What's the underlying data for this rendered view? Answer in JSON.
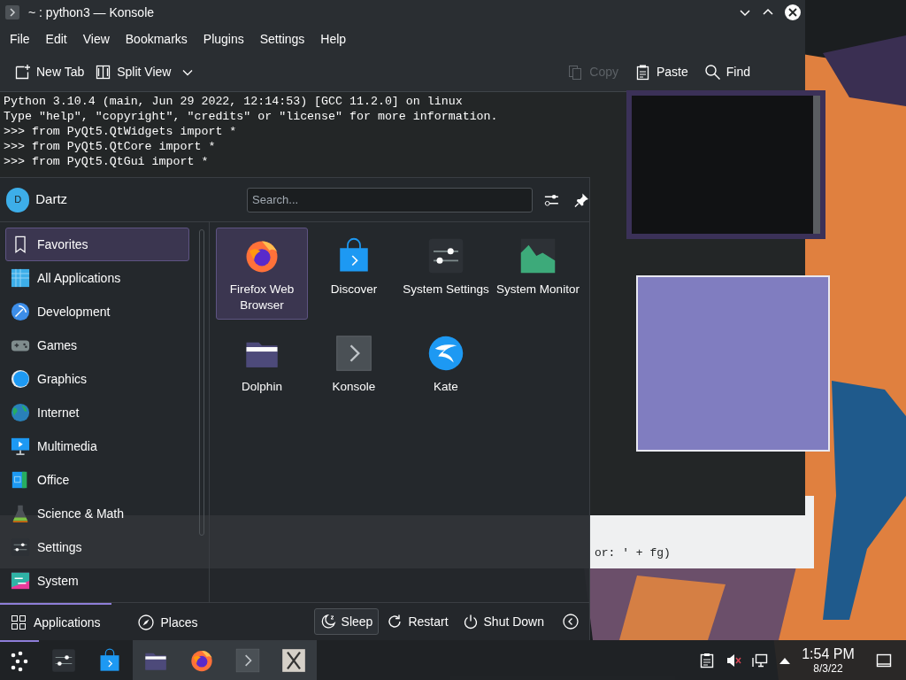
{
  "konsole": {
    "title": "~ : python3 — Konsole",
    "menu": [
      "File",
      "Edit",
      "View",
      "Bookmarks",
      "Plugins",
      "Settings",
      "Help"
    ],
    "toolbar": [
      {
        "kind": "new-tab",
        "label": "New Tab",
        "disabled": false
      },
      {
        "kind": "split-view",
        "label": "Split View",
        "disabled": false
      },
      {
        "kind": "copy",
        "label": "Copy",
        "disabled": true
      },
      {
        "kind": "paste",
        "label": "Paste",
        "disabled": false
      },
      {
        "kind": "find",
        "label": "Find",
        "disabled": false
      }
    ],
    "lines": [
      "Python 3.10.4 (main, Jun 29 2022, 12:14:53) [GCC 11.2.0] on linux",
      "Type \"help\", \"copyright\", \"credits\" or \"license\" for more information.",
      ">>> from PyQt5.QtWidgets import *",
      ">>> from PyQt5.QtCore import *",
      ">>> from PyQt5.QtGui import *"
    ]
  },
  "editor_window": {
    "code_fragment": "or: ' + fg)"
  },
  "launcher": {
    "user": {
      "initial": "D",
      "name": "Dartz"
    },
    "search": {
      "placeholder": "Search..."
    },
    "categories": [
      {
        "kind": "favorites",
        "label": "Favorites",
        "selected": true
      },
      {
        "kind": "all",
        "label": "All Applications",
        "selected": false
      },
      {
        "kind": "development",
        "label": "Development",
        "selected": false
      },
      {
        "kind": "games",
        "label": "Games",
        "selected": false
      },
      {
        "kind": "graphics",
        "label": "Graphics",
        "selected": false
      },
      {
        "kind": "internet",
        "label": "Internet",
        "selected": false
      },
      {
        "kind": "multimedia",
        "label": "Multimedia",
        "selected": false
      },
      {
        "kind": "office",
        "label": "Office",
        "selected": false
      },
      {
        "kind": "science",
        "label": "Science & Math",
        "selected": false
      },
      {
        "kind": "settings",
        "label": "Settings",
        "selected": false
      },
      {
        "kind": "system",
        "label": "System",
        "selected": false
      }
    ],
    "apps": [
      {
        "kind": "firefox",
        "label": "Firefox Web Browser",
        "selected": true
      },
      {
        "kind": "discover",
        "label": "Discover",
        "selected": false
      },
      {
        "kind": "system-settings",
        "label": "System Settings",
        "selected": false
      },
      {
        "kind": "system-monitor",
        "label": "System Monitor",
        "selected": false
      },
      {
        "kind": "dolphin",
        "label": "Dolphin",
        "selected": false
      },
      {
        "kind": "konsole",
        "label": "Konsole",
        "selected": false
      },
      {
        "kind": "kate",
        "label": "Kate",
        "selected": false
      }
    ],
    "tabs": [
      {
        "kind": "applications",
        "label": "Applications",
        "selected": true
      },
      {
        "kind": "places",
        "label": "Places",
        "selected": false
      }
    ],
    "power": [
      {
        "kind": "sleep",
        "label": "Sleep",
        "focused": true
      },
      {
        "kind": "restart",
        "label": "Restart",
        "focused": false
      },
      {
        "kind": "shutdown",
        "label": "Shut Down",
        "focused": false
      }
    ]
  },
  "taskbar": {
    "launcher_open": true,
    "tasks": [
      {
        "kind": "system-settings",
        "running": false
      },
      {
        "kind": "discover",
        "running": false
      },
      {
        "kind": "dolphin",
        "running": true
      },
      {
        "kind": "firefox",
        "running": true
      },
      {
        "kind": "konsole",
        "running": true
      },
      {
        "kind": "x-app",
        "running": true
      }
    ],
    "clock": {
      "time": "1:54 PM",
      "date": "8/3/22"
    }
  }
}
